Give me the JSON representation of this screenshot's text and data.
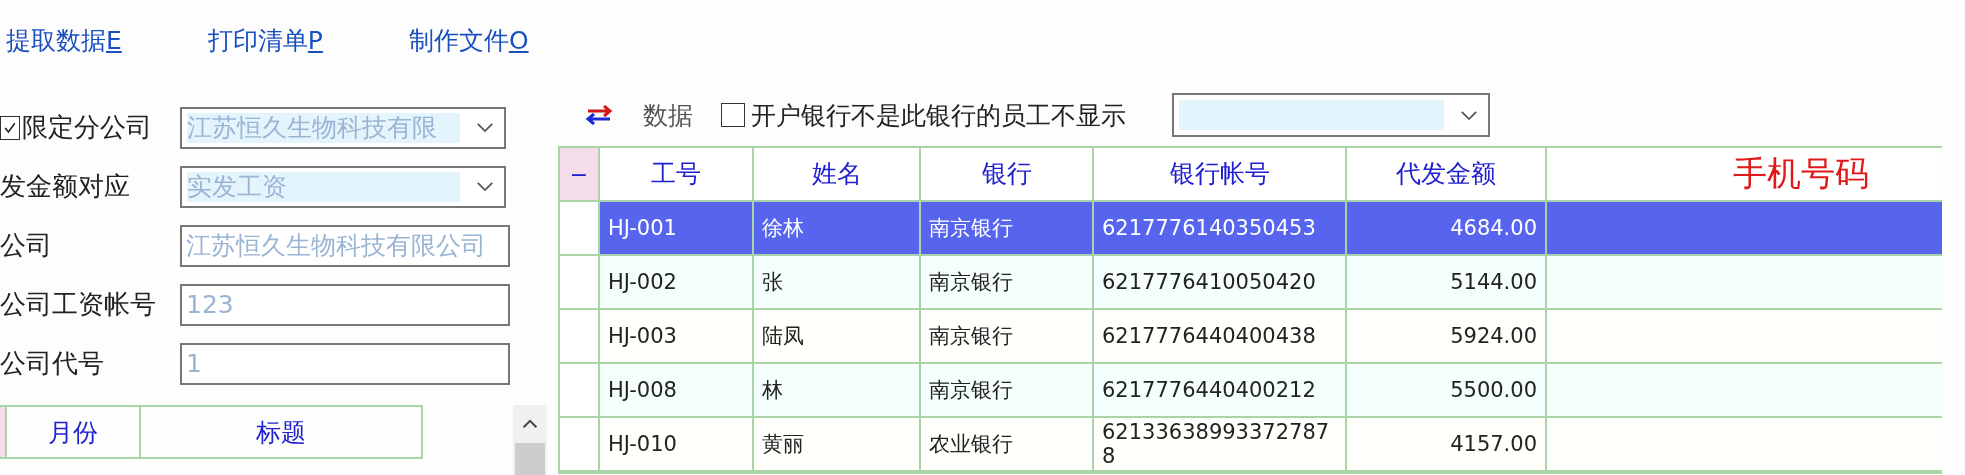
{
  "toolbar": [
    {
      "label": "提取数据",
      "accelerator": "E"
    },
    {
      "label": "打印清单",
      "accelerator": "P"
    },
    {
      "label": "制作文件",
      "accelerator": "O"
    }
  ],
  "form": [
    {
      "kind": "checkbox",
      "label": "限定分公司",
      "checked": true,
      "input": {
        "kind": "dropdown",
        "value": "江苏恒久生物科技有限"
      }
    },
    {
      "kind": "label",
      "label": "发金额对应",
      "input": {
        "kind": "dropdown",
        "value": "实发工资"
      }
    },
    {
      "kind": "label",
      "label": "公司",
      "input": {
        "kind": "text",
        "value": "江苏恒久生物科技有限公司"
      }
    },
    {
      "kind": "label",
      "label": "公司工资帐号",
      "input": {
        "kind": "text",
        "value": "123"
      }
    },
    {
      "kind": "label",
      "label": "公司代号",
      "input": {
        "kind": "text",
        "value": "1"
      }
    }
  ],
  "month_table": {
    "columns": [
      "月份",
      "标题"
    ]
  },
  "filter_bar": {
    "label": "数据",
    "hide_other_bank": {
      "label": "开户银行不是此银行的员工不显示",
      "checked": false
    }
  },
  "table": {
    "indicator": "−",
    "columns": [
      {
        "label": "工号",
        "kind": "normal"
      },
      {
        "label": "姓名",
        "kind": "normal"
      },
      {
        "label": "银行",
        "kind": "normal"
      },
      {
        "label": "银行帐号",
        "kind": "normal"
      },
      {
        "label": "代发金额",
        "kind": "normal"
      },
      {
        "label": "手机号码",
        "kind": "highlight"
      }
    ],
    "rows": [
      {
        "selected": true,
        "cells": [
          "HJ-001",
          "徐林",
          "南京银行",
          "6217776140350453",
          "4684.00",
          ""
        ]
      },
      {
        "selected": false,
        "cells": [
          "HJ-002",
          "张",
          "南京银行",
          "6217776410050420",
          "5144.00",
          ""
        ]
      },
      {
        "selected": false,
        "cells": [
          "HJ-003",
          "陆凤",
          "南京银行",
          "6217776440400438",
          "5924.00",
          ""
        ]
      },
      {
        "selected": false,
        "cells": [
          "HJ-008",
          "林",
          "南京银行",
          "6217776440400212",
          "5500.00",
          ""
        ]
      },
      {
        "selected": false,
        "cells": [
          "HJ-010",
          "黄丽",
          "农业银行",
          "621336389933727878",
          "4157.00",
          ""
        ]
      }
    ]
  }
}
